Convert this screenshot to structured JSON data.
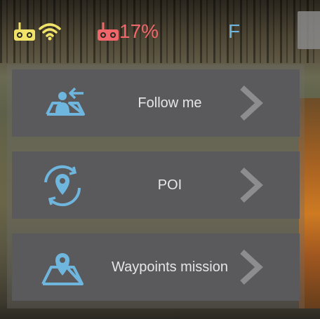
{
  "status_bar": {
    "rc_icon": "remote-controller-icon",
    "wifi_icon": "wifi-signal-icon",
    "aircraft_battery_icon": "aircraft-battery-icon",
    "battery_percent": "17%",
    "flight_mode": "F",
    "colors": {
      "rc": "#f1e26a",
      "battery": "#f0666a",
      "mode": "#6fb6df"
    }
  },
  "menu": {
    "items": [
      {
        "label": "Follow me",
        "icon": "follow-me-icon",
        "chevron": "chevron-right-icon"
      },
      {
        "label": "POI",
        "icon": "poi-orbit-icon",
        "chevron": "chevron-right-icon"
      },
      {
        "label": "Waypoints mission",
        "icon": "waypoints-map-icon",
        "chevron": "chevron-right-icon"
      }
    ],
    "colors": {
      "icon": "#6fb6df",
      "chevron": "#8d8d8f",
      "label": "#e6e6e6"
    }
  }
}
